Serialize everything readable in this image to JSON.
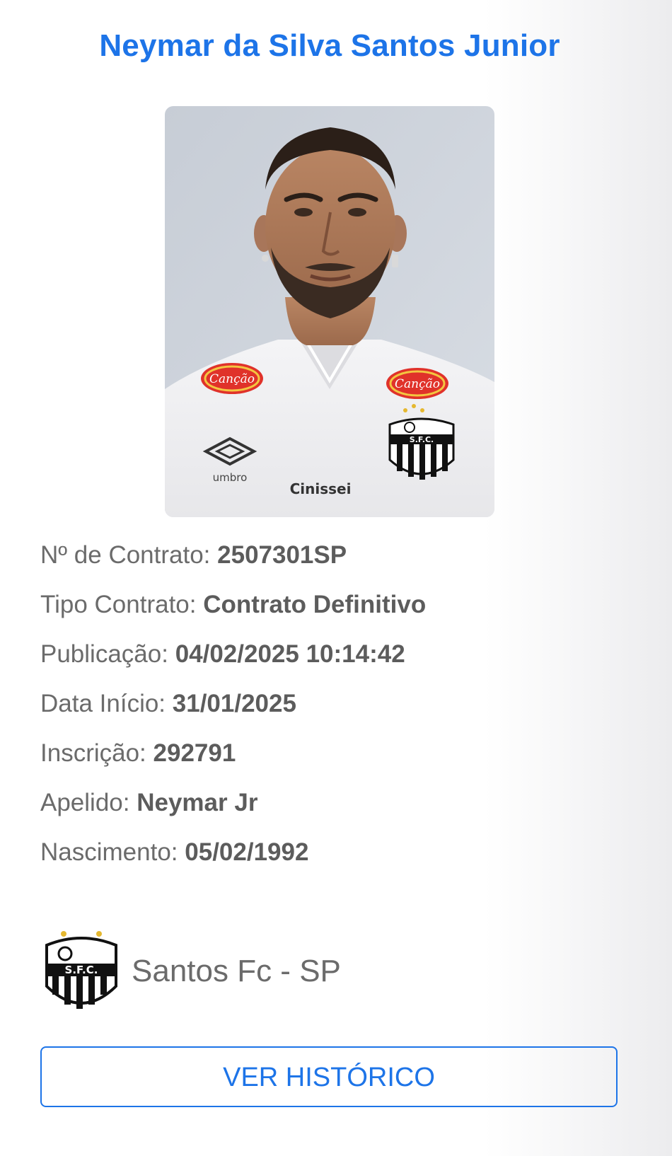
{
  "player": {
    "name": "Neymar da Silva Santos Junior"
  },
  "contract": [
    {
      "label": "Nº de Contrato:",
      "value": "2507301SP"
    },
    {
      "label": "Tipo Contrato:",
      "value": "Contrato Definitivo"
    },
    {
      "label": "Publicação:",
      "value": "04/02/2025 10:14:42"
    },
    {
      "label": "Data Início:",
      "value": "31/01/2025"
    },
    {
      "label": "Inscrição:",
      "value": "292791"
    },
    {
      "label": "Apelido:",
      "value": "Neymar Jr"
    },
    {
      "label": "Nascimento:",
      "value": "05/02/1992"
    }
  ],
  "club": {
    "name": "Santos Fc - SP",
    "crest_icon": "santos-crest-icon",
    "crest_text": "S.F.C."
  },
  "photo": {
    "shirt_sponsor": "Canção",
    "shirt_brand": "umbro",
    "shirt_front_sponsor": "Cinissei"
  },
  "actions": {
    "history_label": "VER HISTÓRICO"
  },
  "colors": {
    "accent": "#1d74e8",
    "label_text": "#6b6b6b",
    "value_text": "#5c5c5c"
  }
}
